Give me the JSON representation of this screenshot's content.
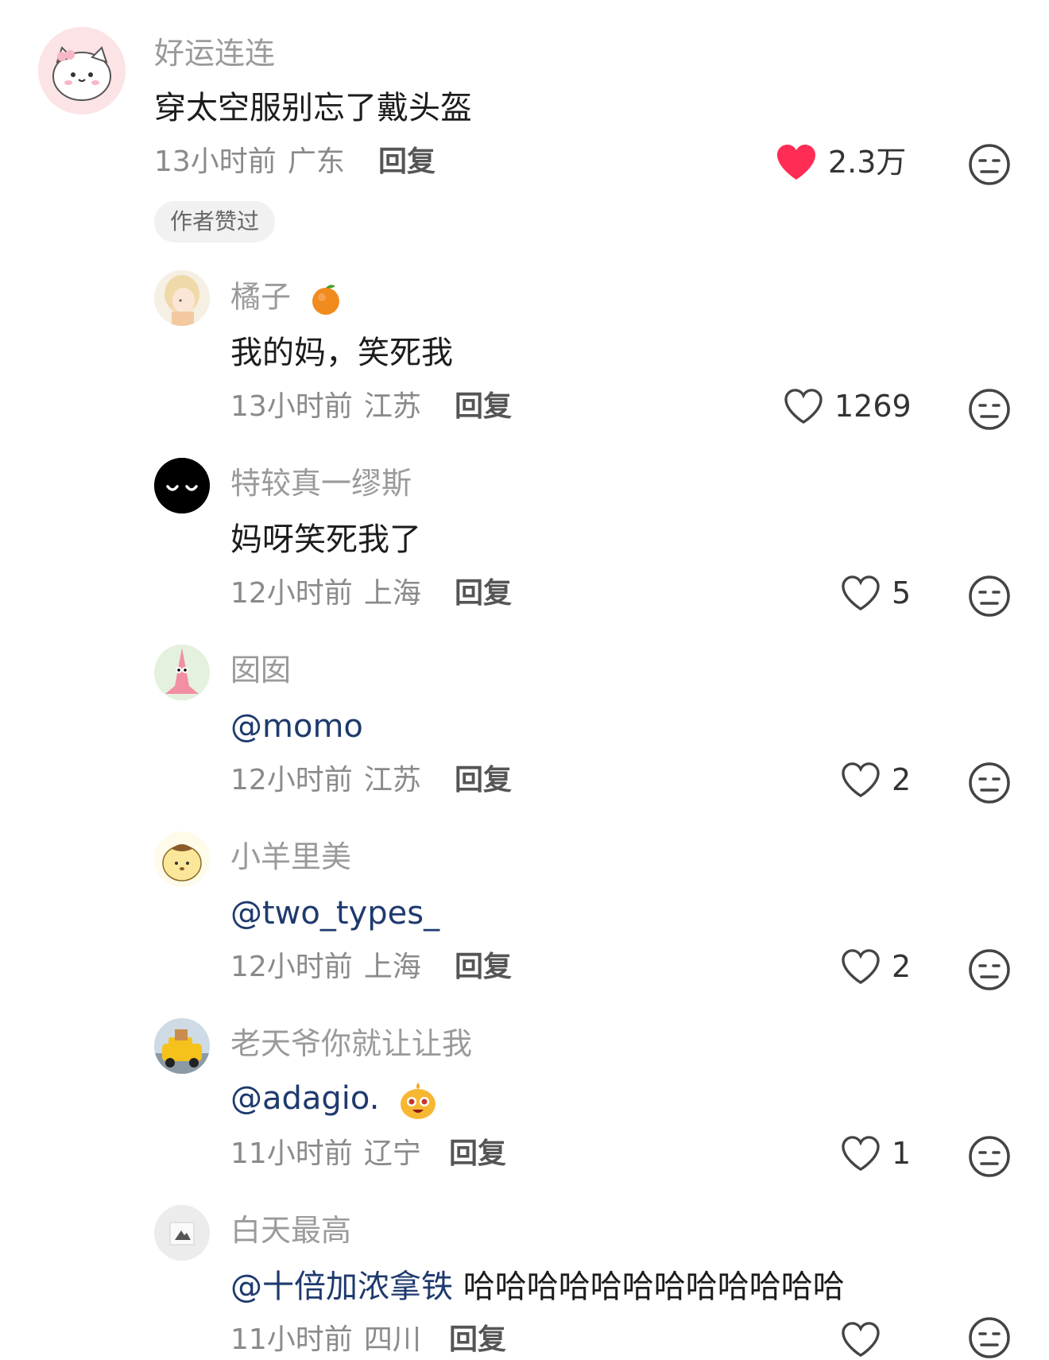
{
  "colors": {
    "liked_heart": "#ff2d55",
    "mention": "#1e3a6e",
    "muted": "#9a9a9a"
  },
  "main_comment": {
    "username": "好运连连",
    "text": "穿太空服别忘了戴头盔",
    "time": "13小时前",
    "location": "广东",
    "reply_label": "回复",
    "likes": "2.3万",
    "liked": true,
    "badge": "作者赞过",
    "avatar_icon": "white-cat-with-bow-avatar"
  },
  "replies": [
    {
      "username": "橘子",
      "name_emoji": "tangerine-emoji",
      "text": "我的妈，笑死我",
      "mention": "",
      "time": "13小时前",
      "location": "江苏",
      "reply_label": "回复",
      "likes": "1269",
      "avatar_icon": "anime-girl-avatar"
    },
    {
      "username": "特较真一缪斯",
      "text": "妈呀笑死我了",
      "mention": "",
      "time": "12小时前",
      "location": "上海",
      "reply_label": "回复",
      "likes": "5",
      "avatar_icon": "black-sleepy-face-avatar"
    },
    {
      "username": "囡囡",
      "text": "",
      "mention": "@momo",
      "time": "12小时前",
      "location": "江苏",
      "reply_label": "回复",
      "likes": "2",
      "avatar_icon": "patrick-star-avatar"
    },
    {
      "username": "小羊里美",
      "text": "",
      "mention": "@two_types_",
      "time": "12小时前",
      "location": "上海",
      "reply_label": "回复",
      "likes": "2",
      "avatar_icon": "pompompurin-avatar"
    },
    {
      "username": "老天爷你就让让我",
      "text": "",
      "mention": "@adagio.",
      "trailing_emoji": "cute-face-emoji",
      "time": "11小时前",
      "location": "辽宁",
      "reply_label": "回复",
      "likes": "1",
      "avatar_icon": "yellow-toy-car-avatar"
    },
    {
      "username": "白天最高",
      "text": "哈哈哈哈哈哈哈哈哈哈哈哈",
      "mention": "@十倍加浓拿铁",
      "time": "11小时前",
      "location": "四川",
      "reply_label": "回复",
      "likes": "",
      "avatar_icon": "mountain-photo-avatar"
    }
  ]
}
